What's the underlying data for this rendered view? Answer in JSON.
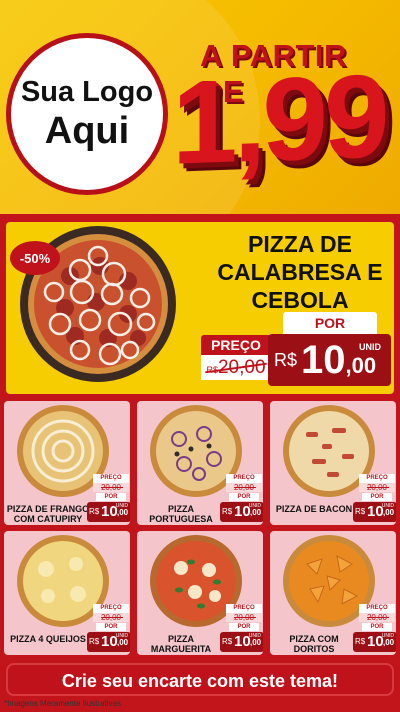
{
  "logo": {
    "line1": "Sua Logo",
    "line2": "Aqui"
  },
  "promo": {
    "label": "A PARTIR DE",
    "price": "1,99"
  },
  "featured": {
    "discount": "-50%",
    "title": "PIZZA DE CALABRESA E CEBOLA",
    "preco_label": "PREÇO",
    "old_currency": "R$",
    "old_price": "20,00",
    "por_label": "POR",
    "unid": "UNID",
    "currency": "R$",
    "price_int": "10",
    "price_dec": ",00"
  },
  "products": [
    {
      "name": "PIZZA DE FRANGO COM CATUPIRY",
      "preco": "PREÇO",
      "old": "20,00",
      "por": "POR",
      "cur": "R$",
      "int": "10",
      "dec": ",00",
      "unid": "UNID"
    },
    {
      "name": "PIZZA PORTUGUESA",
      "preco": "PREÇO",
      "old": "20,00",
      "por": "POR",
      "cur": "R$",
      "int": "10",
      "dec": ",00",
      "unid": "UNID"
    },
    {
      "name": "PIZZA DE BACON",
      "preco": "PREÇO",
      "old": "20,00",
      "por": "POR",
      "cur": "R$",
      "int": "10",
      "dec": ",00",
      "unid": "UNID"
    },
    {
      "name": "PIZZA 4 QUEIJOS",
      "preco": "PREÇO",
      "old": "20,00",
      "por": "POR",
      "cur": "R$",
      "int": "10",
      "dec": ",00",
      "unid": "UNID"
    },
    {
      "name": "PIZZA MARGUERITA",
      "preco": "PREÇO",
      "old": "20,00",
      "por": "POR",
      "cur": "R$",
      "int": "10",
      "dec": ",00",
      "unid": "UNID"
    },
    {
      "name": "PIZZA COM DORITOS",
      "preco": "PREÇO",
      "old": "20,00",
      "por": "POR",
      "cur": "R$",
      "int": "10",
      "dec": ",00",
      "unid": "UNID"
    }
  ],
  "cta": "Crie seu encarte com este tema!",
  "footnote": "*Imagens Meramente Ilustrativas",
  "colors": {
    "brand_red": "#c0121a",
    "dark_red": "#9c0f14",
    "yellow": "#f6cd00",
    "card_pink": "#f4c6cc"
  }
}
